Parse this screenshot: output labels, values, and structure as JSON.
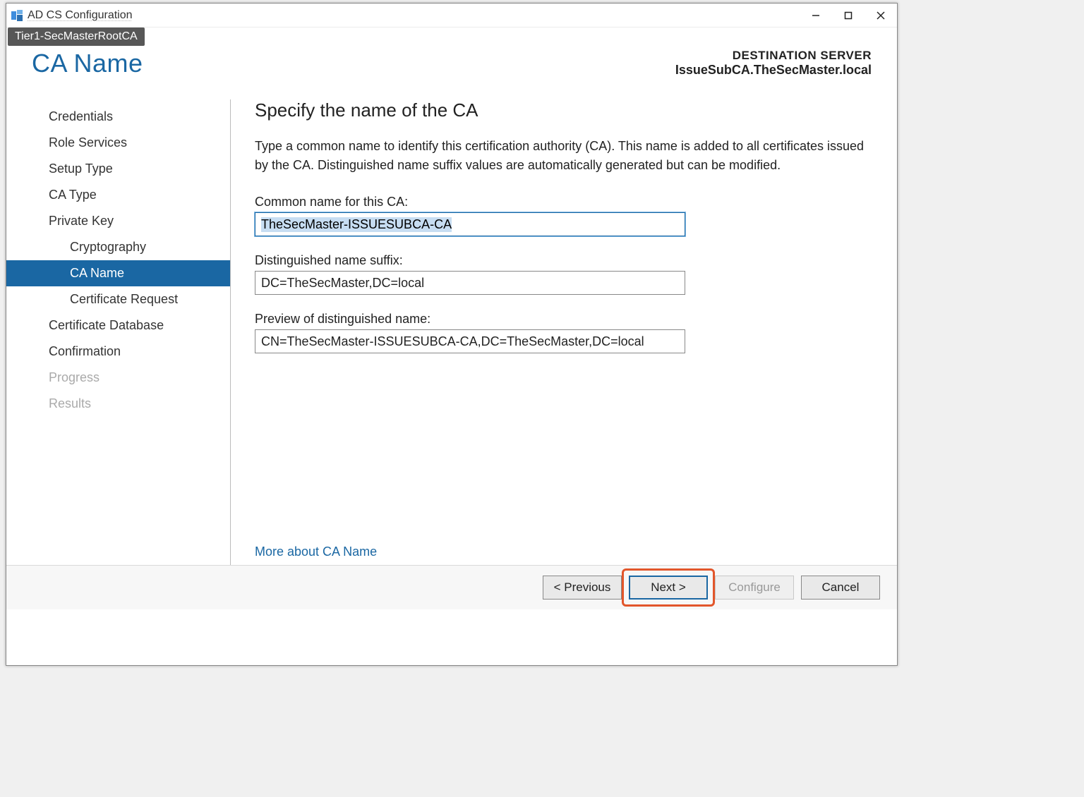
{
  "window": {
    "title": "AD CS Configuration",
    "tooltip": "Tier1-SecMasterRootCA"
  },
  "header": {
    "page_title": "CA Name",
    "dest_label": "DESTINATION SERVER",
    "dest_value": "IssueSubCA.TheSecMaster.local"
  },
  "sidebar": {
    "items": [
      {
        "label": "Credentials",
        "level": 0,
        "active": false,
        "disabled": false
      },
      {
        "label": "Role Services",
        "level": 0,
        "active": false,
        "disabled": false
      },
      {
        "label": "Setup Type",
        "level": 0,
        "active": false,
        "disabled": false
      },
      {
        "label": "CA Type",
        "level": 0,
        "active": false,
        "disabled": false
      },
      {
        "label": "Private Key",
        "level": 0,
        "active": false,
        "disabled": false
      },
      {
        "label": "Cryptography",
        "level": 1,
        "active": false,
        "disabled": false
      },
      {
        "label": "CA Name",
        "level": 1,
        "active": true,
        "disabled": false
      },
      {
        "label": "Certificate Request",
        "level": 1,
        "active": false,
        "disabled": false
      },
      {
        "label": "Certificate Database",
        "level": 0,
        "active": false,
        "disabled": false
      },
      {
        "label": "Confirmation",
        "level": 0,
        "active": false,
        "disabled": false
      },
      {
        "label": "Progress",
        "level": 0,
        "active": false,
        "disabled": true
      },
      {
        "label": "Results",
        "level": 0,
        "active": false,
        "disabled": true
      }
    ]
  },
  "main": {
    "heading": "Specify the name of the CA",
    "description": "Type a common name to identify this certification authority (CA). This name is added to all certificates issued by the CA. Distinguished name suffix values are automatically generated but can be modified.",
    "common_name_label": "Common name for this CA:",
    "common_name_value": "TheSecMaster-ISSUESUBCA-CA",
    "dn_suffix_label": "Distinguished name suffix:",
    "dn_suffix_value": "DC=TheSecMaster,DC=local",
    "preview_label": "Preview of distinguished name:",
    "preview_value": "CN=TheSecMaster-ISSUESUBCA-CA,DC=TheSecMaster,DC=local",
    "more_link": "More about CA Name"
  },
  "footer": {
    "previous": "< Previous",
    "next": "Next >",
    "configure": "Configure",
    "cancel": "Cancel"
  }
}
